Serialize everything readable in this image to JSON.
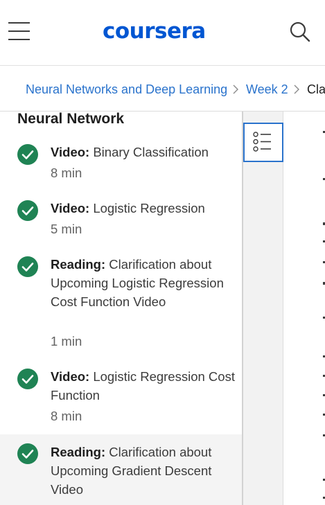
{
  "header": {
    "logo_text": "coursera",
    "brand_color": "#0056d2",
    "menu_icon": "hamburger-menu-icon",
    "search_icon": "search-icon"
  },
  "breadcrumb": {
    "items": [
      {
        "label": "Neural Networks and Deep Learning"
      },
      {
        "label": "Week 2"
      },
      {
        "label": "Cla"
      }
    ],
    "separator_icon": "chevron-right-icon"
  },
  "sidebar": {
    "section_title": "Neural Network",
    "status_color": "#1f8354",
    "status_icon": "check-circle-icon",
    "items": [
      {
        "type": "Video:",
        "title": "Binary Classification",
        "duration": "8 min"
      },
      {
        "type": "Video:",
        "title": "Logistic Regression",
        "duration": "5 min"
      },
      {
        "type": "Reading:",
        "title": "Clarification about Upcoming Logistic Regression Cost Function Video",
        "duration": "1 min"
      },
      {
        "type": "Video:",
        "title": "Logistic Regression Cost Function",
        "duration": "8 min"
      },
      {
        "type": "Reading:",
        "title": "Clarification about Upcoming Gradient Descent Video",
        "duration": ""
      }
    ]
  },
  "toolbar": {
    "outline_icon": "list-outline-icon",
    "accent_color": "#2a73cc"
  }
}
